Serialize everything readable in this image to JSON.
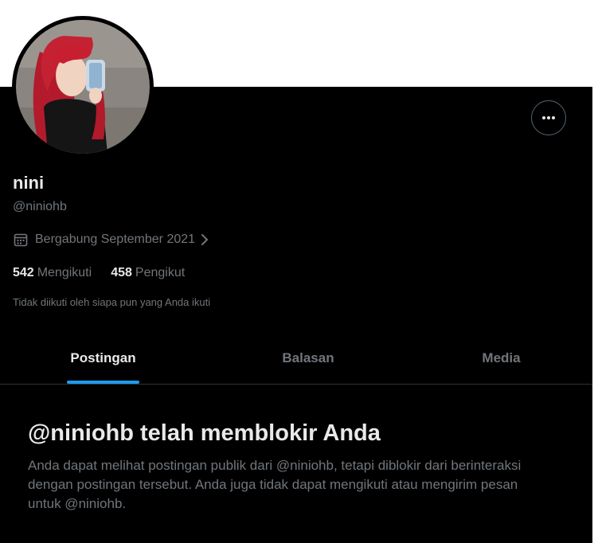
{
  "profile": {
    "display_name": "nini",
    "handle": "@niniohb",
    "joined": "Bergabung September 2021",
    "following_count": "542",
    "following_label": "Mengikuti",
    "followers_count": "458",
    "followers_label": "Pengikut",
    "followed_by_note": "Tidak diikuti oleh siapa pun yang Anda ikuti"
  },
  "icons": {
    "more": "ellipsis-icon",
    "calendar": "calendar-icon",
    "chevron": "chevron-right-icon"
  },
  "tabs": [
    {
      "label": "Postingan",
      "active": true
    },
    {
      "label": "Balasan",
      "active": false
    },
    {
      "label": "Media",
      "active": false
    }
  ],
  "blocked": {
    "title": "@niniohb telah memblokir Anda",
    "description": "Anda dapat melihat postingan publik dari @niniohb, tetapi diblokir dari berinteraksi dengan postingan tersebut. Anda juga tidak dapat mengikuti atau mengirim pesan untuk @niniohb."
  },
  "colors": {
    "background": "#000000",
    "primary_text": "#e7e9ea",
    "secondary_text": "#71767b",
    "accent": "#1d9bf0",
    "divider": "#2f3336"
  }
}
